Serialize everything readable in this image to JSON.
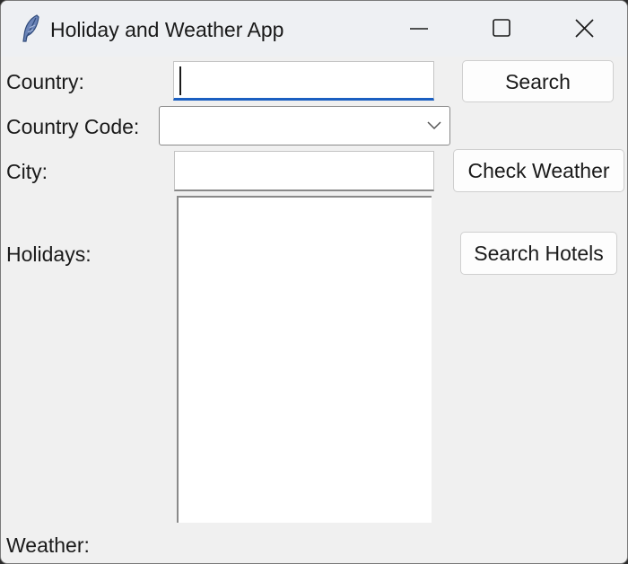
{
  "window": {
    "title": "Holiday and Weather App",
    "icon": "feather-icon"
  },
  "controls": {
    "minimize_icon": "minimize-icon",
    "maximize_icon": "maximize-icon",
    "close_icon": "close-icon"
  },
  "form": {
    "country_label": "Country:",
    "country_value": "",
    "country_code_label": "Country Code:",
    "country_code_value": "",
    "city_label": "City:",
    "city_value": "",
    "holidays_label": "Holidays:",
    "holidays_items": [],
    "weather_label": "Weather:"
  },
  "buttons": {
    "search": "Search",
    "check_weather": "Check Weather",
    "search_hotels": "Search Hotels"
  },
  "colors": {
    "focus_accent": "#1b5fc1",
    "window_bg": "#f0f0f0",
    "titlebar_bg": "#eef0f3"
  }
}
